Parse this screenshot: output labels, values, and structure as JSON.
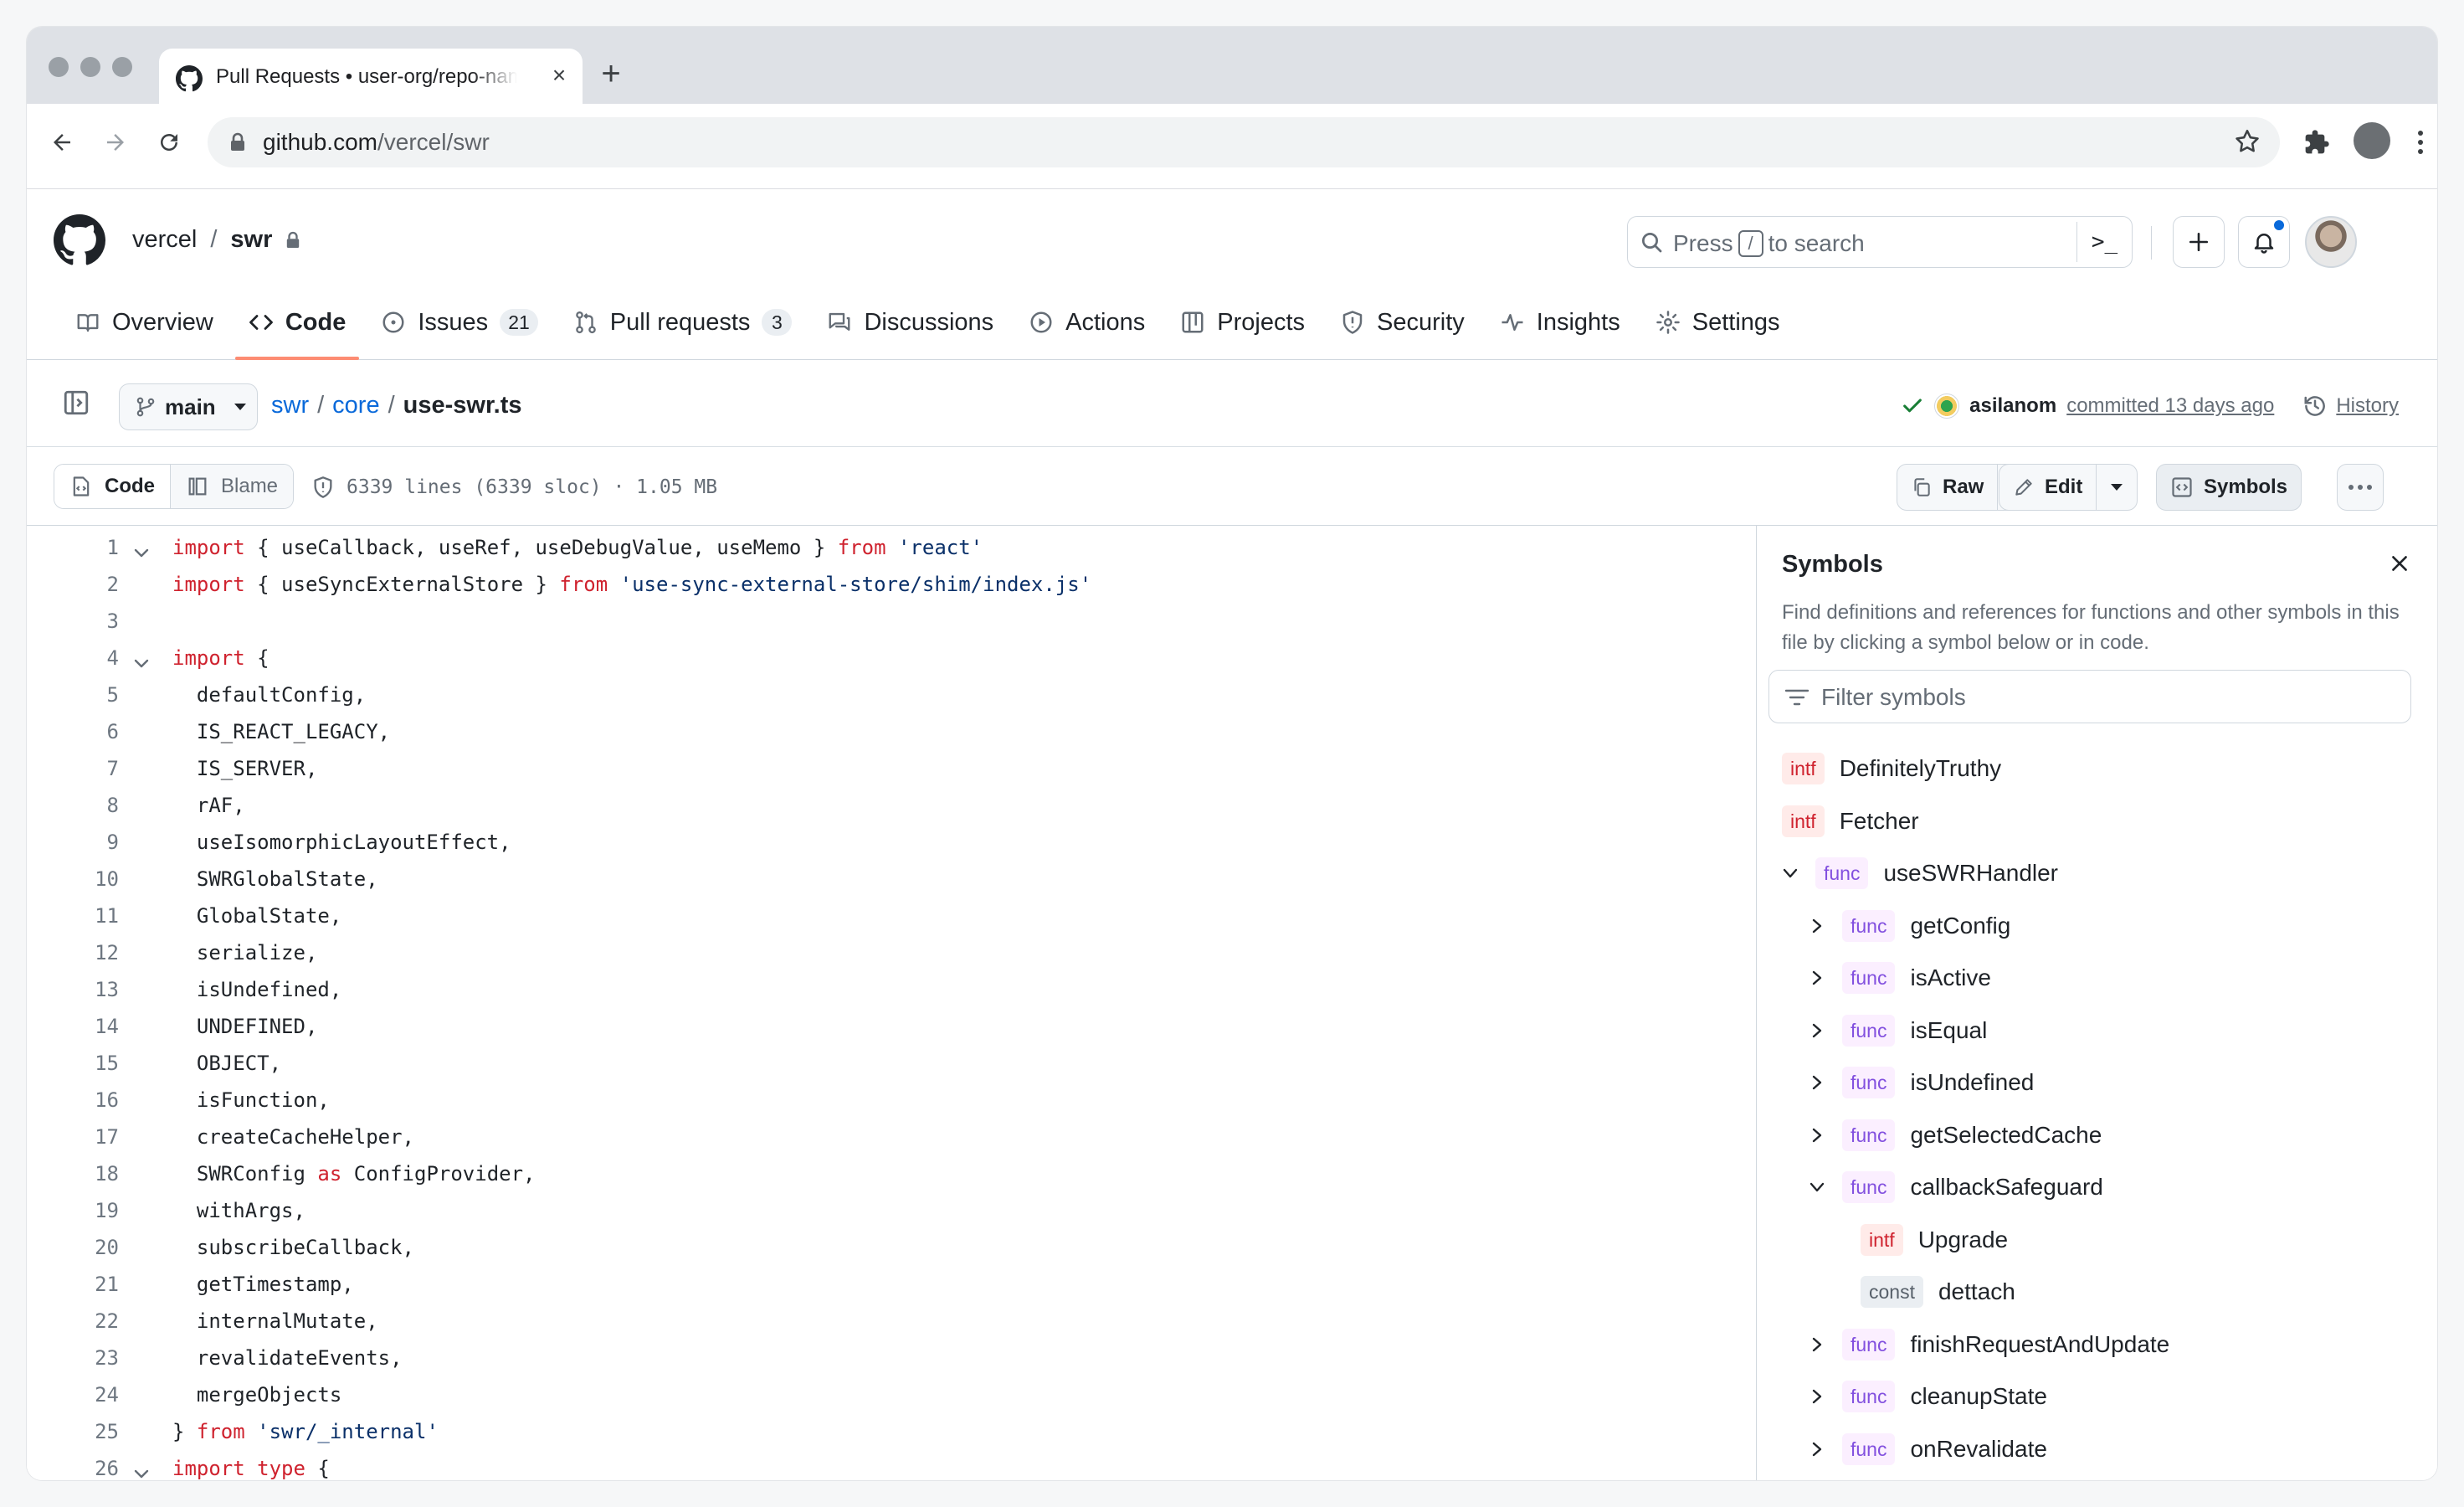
{
  "browser": {
    "tab_title": "Pull Requests • user-org/repo-name",
    "url_host": "github.com",
    "url_path": "/vercel/swr"
  },
  "repo": {
    "owner": "vercel",
    "separator": "/",
    "name": "swr"
  },
  "search": {
    "prefix": "Press",
    "key": "/",
    "suffix": "to search",
    "command": ">_"
  },
  "nav": {
    "overview": "Overview",
    "code": "Code",
    "issues": "Issues",
    "issues_count": "21",
    "pulls": "Pull requests",
    "pulls_count": "3",
    "discussions": "Discussions",
    "actions": "Actions",
    "projects": "Projects",
    "security": "Security",
    "insights": "Insights",
    "settings": "Settings"
  },
  "file": {
    "branch": "main",
    "crumb_repo": "swr",
    "crumb_dir": "core",
    "crumb_file": "use-swr.ts",
    "author": "asilanom",
    "committed": "committed 13 days ago",
    "history": "History",
    "view_code": "Code",
    "view_blame": "Blame",
    "info": "6339 lines (6339 sloc) · 1.05 MB",
    "raw": "Raw",
    "edit": "Edit",
    "symbols": "Symbols"
  },
  "code_lines": [
    {
      "n": "1",
      "fold": true,
      "parts": [
        [
          "kw",
          "import"
        ],
        [
          "p",
          " { useCallback, useRef, useDebugValue, useMemo } "
        ],
        [
          "kw",
          "from"
        ],
        [
          "p",
          " "
        ],
        [
          "str",
          "'react'"
        ]
      ]
    },
    {
      "n": "2",
      "fold": false,
      "parts": [
        [
          "kw",
          "import"
        ],
        [
          "p",
          " { useSyncExternalStore } "
        ],
        [
          "kw",
          "from"
        ],
        [
          "p",
          " "
        ],
        [
          "str",
          "'use-sync-external-store/shim/index.js'"
        ]
      ]
    },
    {
      "n": "3",
      "fold": false,
      "parts": []
    },
    {
      "n": "4",
      "fold": true,
      "parts": [
        [
          "kw",
          "import"
        ],
        [
          "p",
          " {"
        ]
      ]
    },
    {
      "n": "5",
      "fold": false,
      "parts": [
        [
          "p",
          "  defaultConfig,"
        ]
      ]
    },
    {
      "n": "6",
      "fold": false,
      "parts": [
        [
          "p",
          "  IS_REACT_LEGACY,"
        ]
      ]
    },
    {
      "n": "7",
      "fold": false,
      "parts": [
        [
          "p",
          "  IS_SERVER,"
        ]
      ]
    },
    {
      "n": "8",
      "fold": false,
      "parts": [
        [
          "p",
          "  rAF,"
        ]
      ]
    },
    {
      "n": "9",
      "fold": false,
      "parts": [
        [
          "p",
          "  useIsomorphicLayoutEffect,"
        ]
      ]
    },
    {
      "n": "10",
      "fold": false,
      "parts": [
        [
          "p",
          "  SWRGlobalState,"
        ]
      ]
    },
    {
      "n": "11",
      "fold": false,
      "parts": [
        [
          "p",
          "  GlobalState,"
        ]
      ]
    },
    {
      "n": "12",
      "fold": false,
      "parts": [
        [
          "p",
          "  serialize,"
        ]
      ]
    },
    {
      "n": "13",
      "fold": false,
      "parts": [
        [
          "p",
          "  isUndefined,"
        ]
      ]
    },
    {
      "n": "14",
      "fold": false,
      "parts": [
        [
          "p",
          "  UNDEFINED,"
        ]
      ]
    },
    {
      "n": "15",
      "fold": false,
      "parts": [
        [
          "p",
          "  OBJECT,"
        ]
      ]
    },
    {
      "n": "16",
      "fold": false,
      "parts": [
        [
          "p",
          "  isFunction,"
        ]
      ]
    },
    {
      "n": "17",
      "fold": false,
      "parts": [
        [
          "p",
          "  createCacheHelper,"
        ]
      ]
    },
    {
      "n": "18",
      "fold": false,
      "parts": [
        [
          "p",
          "  SWRConfig "
        ],
        [
          "kw",
          "as"
        ],
        [
          "p",
          " ConfigProvider,"
        ]
      ]
    },
    {
      "n": "19",
      "fold": false,
      "parts": [
        [
          "p",
          "  withArgs,"
        ]
      ]
    },
    {
      "n": "20",
      "fold": false,
      "parts": [
        [
          "p",
          "  subscribeCallback,"
        ]
      ]
    },
    {
      "n": "21",
      "fold": false,
      "parts": [
        [
          "p",
          "  getTimestamp,"
        ]
      ]
    },
    {
      "n": "22",
      "fold": false,
      "parts": [
        [
          "p",
          "  internalMutate,"
        ]
      ]
    },
    {
      "n": "23",
      "fold": false,
      "parts": [
        [
          "p",
          "  revalidateEvents,"
        ]
      ]
    },
    {
      "n": "24",
      "fold": false,
      "parts": [
        [
          "p",
          "  mergeObjects"
        ]
      ]
    },
    {
      "n": "25",
      "fold": false,
      "parts": [
        [
          "p",
          "} "
        ],
        [
          "kw",
          "from"
        ],
        [
          "p",
          " "
        ],
        [
          "str",
          "'swr/_internal'"
        ]
      ]
    },
    {
      "n": "26",
      "fold": true,
      "parts": [
        [
          "kw",
          "import"
        ],
        [
          "p",
          " "
        ],
        [
          "kw",
          "type"
        ],
        [
          "p",
          " {"
        ]
      ]
    }
  ],
  "symbols_panel": {
    "title": "Symbols",
    "description": "Find definitions and references for functions and other symbols in this file by clicking a symbol below or in code.",
    "filter_placeholder": "Filter symbols",
    "items": [
      {
        "kind": "intf",
        "name": "DefinitelyTruthy",
        "depth": 0,
        "chevron": "none"
      },
      {
        "kind": "intf",
        "name": "Fetcher",
        "depth": 0,
        "chevron": "none"
      },
      {
        "kind": "func",
        "name": "useSWRHandler",
        "depth": 0,
        "chevron": "down"
      },
      {
        "kind": "func",
        "name": "getConfig",
        "depth": 1,
        "chevron": "right"
      },
      {
        "kind": "func",
        "name": "isActive",
        "depth": 1,
        "chevron": "right"
      },
      {
        "kind": "func",
        "name": "isEqual",
        "depth": 1,
        "chevron": "right"
      },
      {
        "kind": "func",
        "name": "isUndefined",
        "depth": 1,
        "chevron": "right"
      },
      {
        "kind": "func",
        "name": "getSelectedCache",
        "depth": 1,
        "chevron": "right"
      },
      {
        "kind": "func",
        "name": "callbackSafeguard",
        "depth": 1,
        "chevron": "down"
      },
      {
        "kind": "intf",
        "name": "Upgrade",
        "depth": 2,
        "chevron": "none"
      },
      {
        "kind": "const",
        "name": "dettach",
        "depth": 2,
        "chevron": "none"
      },
      {
        "kind": "func",
        "name": "finishRequestAndUpdate",
        "depth": 1,
        "chevron": "right"
      },
      {
        "kind": "func",
        "name": "cleanupState",
        "depth": 1,
        "chevron": "right"
      },
      {
        "kind": "func",
        "name": "onRevalidate",
        "depth": 1,
        "chevron": "right"
      }
    ]
  }
}
